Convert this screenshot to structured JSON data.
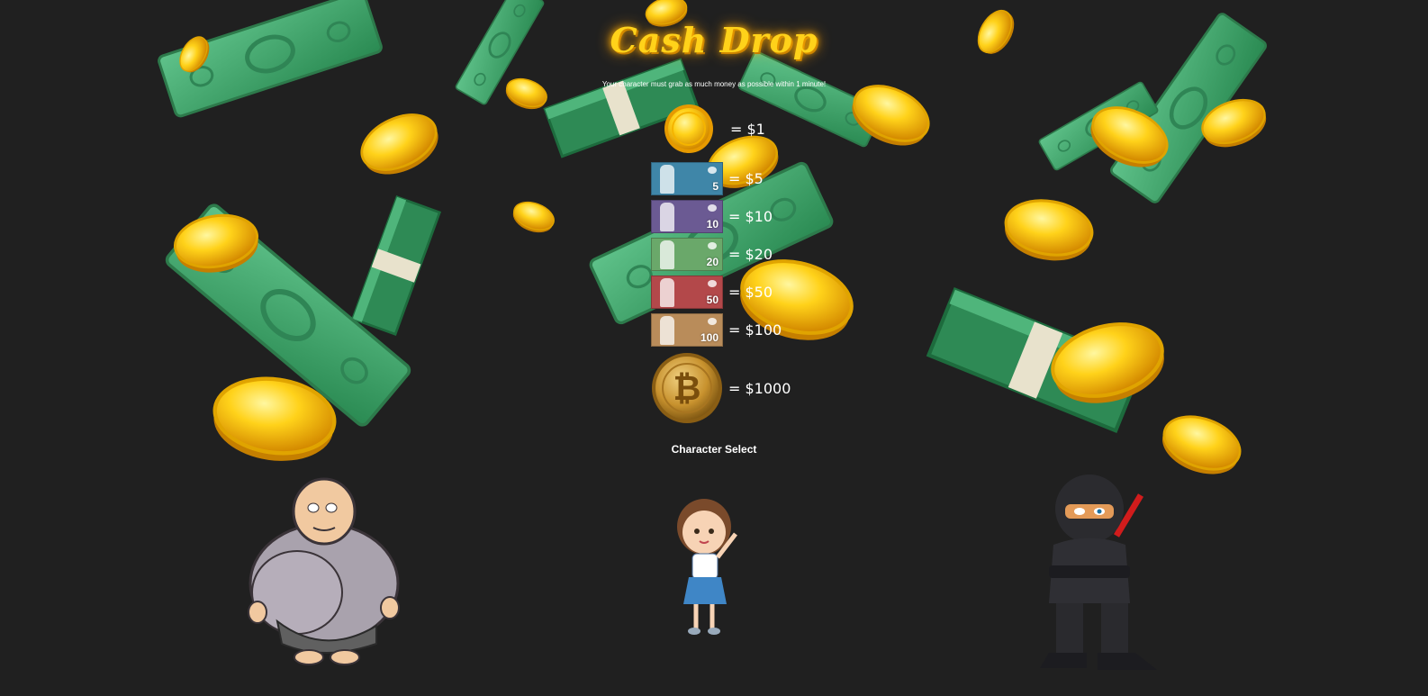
{
  "title": "Cash Drop",
  "subtitle": "Your character must grab as much money as possible within 1 minute!",
  "legend": [
    {
      "kind": "coin",
      "icon": "gold-coin-icon",
      "label": "= $1"
    },
    {
      "kind": "bill",
      "icon": "five-dollar-bill-icon",
      "denomination": "5",
      "color": "#3f86a8",
      "label": "= $5"
    },
    {
      "kind": "bill",
      "icon": "ten-dollar-bill-icon",
      "denomination": "10",
      "color": "#6b5a93",
      "label": "= $10"
    },
    {
      "kind": "bill",
      "icon": "twenty-dollar-bill-icon",
      "denomination": "20",
      "color": "#6aa86a",
      "label": "= $20"
    },
    {
      "kind": "bill",
      "icon": "fifty-dollar-bill-icon",
      "denomination": "50",
      "color": "#b3484a",
      "label": "= $50"
    },
    {
      "kind": "bill",
      "icon": "hundred-dollar-bill-icon",
      "denomination": "100",
      "color": "#b98c5a",
      "label": "= $100"
    },
    {
      "kind": "bitcoin",
      "icon": "bitcoin-icon",
      "label": "= $1000"
    }
  ],
  "character_select": {
    "heading": "Character Select",
    "characters": [
      {
        "name": "big-man",
        "icon": "big-man-character-icon"
      },
      {
        "name": "girl",
        "icon": "girl-character-icon"
      },
      {
        "name": "ninja",
        "icon": "ninja-character-icon"
      }
    ]
  },
  "colors": {
    "background": "#202020",
    "title": "#ffd21a",
    "money_green": "#3aa465",
    "gold": "#f6c21c"
  }
}
